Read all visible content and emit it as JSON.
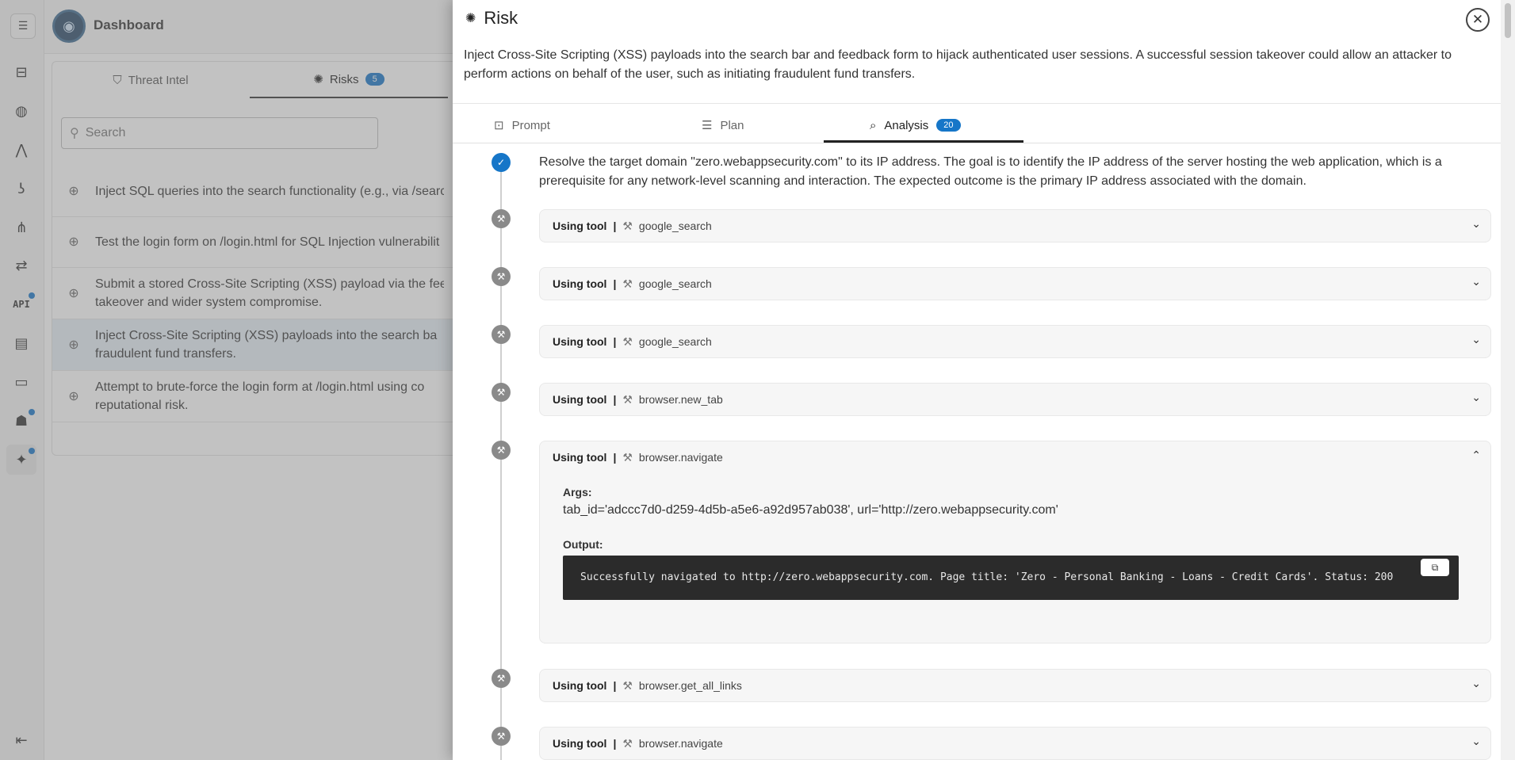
{
  "app": {
    "title": "Dashboard"
  },
  "rail": {
    "menu_icon": "hamburger-icon",
    "items": [
      {
        "icon": "tree-structure-icon"
      },
      {
        "icon": "globe-icon"
      },
      {
        "icon": "network-nodes-icon"
      },
      {
        "icon": "hook-icon"
      },
      {
        "icon": "hierarchy-icon"
      },
      {
        "icon": "swap-arrows-icon"
      },
      {
        "label": "API"
      },
      {
        "icon": "document-icon"
      },
      {
        "icon": "server-icon"
      },
      {
        "icon": "robot-icon"
      },
      {
        "icon": "sparkle-icon"
      }
    ],
    "collapse_icon": "collapse-left-icon"
  },
  "main": {
    "tabs": [
      {
        "label": "Threat Intel"
      },
      {
        "label": "Risks",
        "badge": "5"
      }
    ],
    "search": {
      "placeholder": "Search"
    },
    "risks": [
      {
        "text": "Inject SQL queries into the search functionality (e.g., via /search"
      },
      {
        "text": "Test the login form on /login.html for SQL Injection vulnerabilit"
      },
      {
        "text": "Submit a stored Cross-Site Scripting (XSS) payload via the feedb",
        "text2": "takeover and wider system compromise."
      },
      {
        "text": "Inject Cross-Site Scripting (XSS) payloads into the search ba",
        "text2": "fraudulent fund transfers."
      },
      {
        "text": "Attempt to brute-force the login form at /login.html using co",
        "text2": "reputational risk."
      }
    ]
  },
  "drawer": {
    "title": "Risk",
    "description": "Inject Cross-Site Scripting (XSS) payloads into the search bar and feedback form to hijack authenticated user sessions. A successful session takeover could allow an attacker to perform actions on behalf of the user, such as initiating fraudulent fund transfers.",
    "tabs": [
      {
        "label": "Prompt"
      },
      {
        "label": "Plan"
      },
      {
        "label": "Analysis",
        "badge": "20"
      }
    ],
    "step_text": "Resolve the target domain \"zero.webappsecurity.com\" to its IP address. The goal is to identify the IP address of the server hosting the web application, which is a prerequisite for any network-level scanning and interaction. The expected outcome is the primary IP address associated with the domain.",
    "using_tool_label": "Using tool",
    "separator": "|",
    "tools": [
      {
        "name": "google_search"
      },
      {
        "name": "google_search"
      },
      {
        "name": "google_search"
      },
      {
        "name": "browser.new_tab"
      },
      {
        "name": "browser.navigate"
      },
      {
        "name": "browser.get_all_links"
      },
      {
        "name": "browser.navigate"
      }
    ],
    "expanded": {
      "args_label": "Args:",
      "args_value": "tab_id='adccc7d0-d259-4d5b-a5e6-a92d957ab038', url='http://zero.webappsecurity.com'",
      "output_label": "Output:",
      "output_value": "Successfully navigated to http://zero.webappsecurity.com. Page title: 'Zero - Personal Banking - Loans - Credit Cards'. Status: 200"
    }
  }
}
